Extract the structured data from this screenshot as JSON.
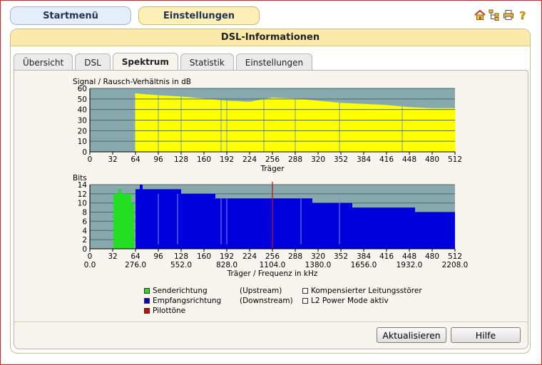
{
  "nav": {
    "start_label": "Startmenü",
    "settings_label": "Einstellungen"
  },
  "panel": {
    "title": "DSL-Informationen"
  },
  "tabs": [
    {
      "label": "Übersicht",
      "active": false
    },
    {
      "label": "DSL",
      "active": false
    },
    {
      "label": "Spektrum",
      "active": true
    },
    {
      "label": "Statistik",
      "active": false
    },
    {
      "label": "Einstellungen",
      "active": false
    }
  ],
  "top_icons": [
    "home-icon",
    "sitemap-icon",
    "printer-icon",
    "help-icon"
  ],
  "colors": {
    "plot_bg": "#87a9ad",
    "snr_fill": "#ffff00",
    "upstream": "#22dd22",
    "downstream": "#0000dd",
    "pilot": "#dd0000"
  },
  "chart_data": [
    {
      "type": "area",
      "ylabel": "Signal / Rausch-Verhältnis in dB",
      "xlabel": "Träger",
      "xlim": [
        0,
        512
      ],
      "ylim": [
        0,
        60
      ],
      "x_ticks": [
        "0",
        "32",
        "64",
        "96",
        "128",
        "160",
        "192",
        "224",
        "256",
        "288",
        "320",
        "352",
        "384",
        "416",
        "448",
        "480",
        "512"
      ],
      "y_ticks": [
        "0",
        "10",
        "20",
        "30",
        "40",
        "50",
        "60"
      ],
      "grid": true,
      "series": [
        {
          "x": [
            64,
            80,
            100,
            128,
            160,
            192,
            224,
            256,
            288,
            320,
            352,
            384,
            416,
            448,
            480,
            512
          ],
          "values": [
            55,
            54,
            53,
            52,
            50,
            48,
            47,
            51,
            50,
            48,
            46,
            45,
            44,
            42,
            41,
            41
          ]
        }
      ],
      "dips": [
        96,
        128,
        184,
        192,
        244,
        288,
        350,
        438
      ]
    },
    {
      "type": "bar",
      "ylabel": "Bits",
      "xlabel": "Träger / Frequenz in kHz",
      "xlim": [
        0,
        512
      ],
      "ylim": [
        0,
        14
      ],
      "x_ticks": [
        "0",
        "32",
        "64",
        "96",
        "128",
        "160",
        "192",
        "224",
        "256",
        "288",
        "320",
        "352",
        "384",
        "416",
        "448",
        "480",
        "512"
      ],
      "freq_ticks": [
        "0.0",
        "276.0",
        "552.0",
        "828.0",
        "1104.0",
        "1380.0",
        "1656.0",
        "1932.0",
        "2208.0"
      ],
      "y_ticks": [
        "0",
        "2",
        "4",
        "6",
        "8",
        "10",
        "12",
        "14"
      ],
      "grid": true,
      "upstream": {
        "segments": [
          [
            33,
            40,
            12
          ],
          [
            40,
            44,
            13
          ],
          [
            44,
            58,
            12
          ],
          [
            58,
            62,
            10
          ]
        ]
      },
      "downstream": {
        "segments": [
          [
            64,
            70,
            13
          ],
          [
            70,
            74,
            14
          ],
          [
            74,
            96,
            13
          ],
          [
            96,
            128,
            13
          ],
          [
            128,
            160,
            12
          ],
          [
            160,
            176,
            12
          ],
          [
            176,
            190,
            11
          ],
          [
            190,
            256,
            11
          ],
          [
            256,
            312,
            11
          ],
          [
            312,
            368,
            10
          ],
          [
            368,
            432,
            9
          ],
          [
            432,
            456,
            9
          ],
          [
            456,
            512,
            8
          ]
        ]
      },
      "pilot_tone": 256,
      "dips": [
        96,
        123,
        184,
        192,
        296,
        350
      ]
    }
  ],
  "legend": {
    "upstream_label": "Senderichtung",
    "upstream_dir": "(Upstream)",
    "downstream_label": "Empfangsrichtung",
    "downstream_dir": "(Downstream)",
    "pilot_label": "Pilottöne",
    "compensated_label": "Kompensierter Leitungsstörer",
    "l2_label": "L2 Power Mode aktiv"
  },
  "buttons": {
    "refresh_label": "Aktualisieren",
    "help_label": "Hilfe"
  }
}
